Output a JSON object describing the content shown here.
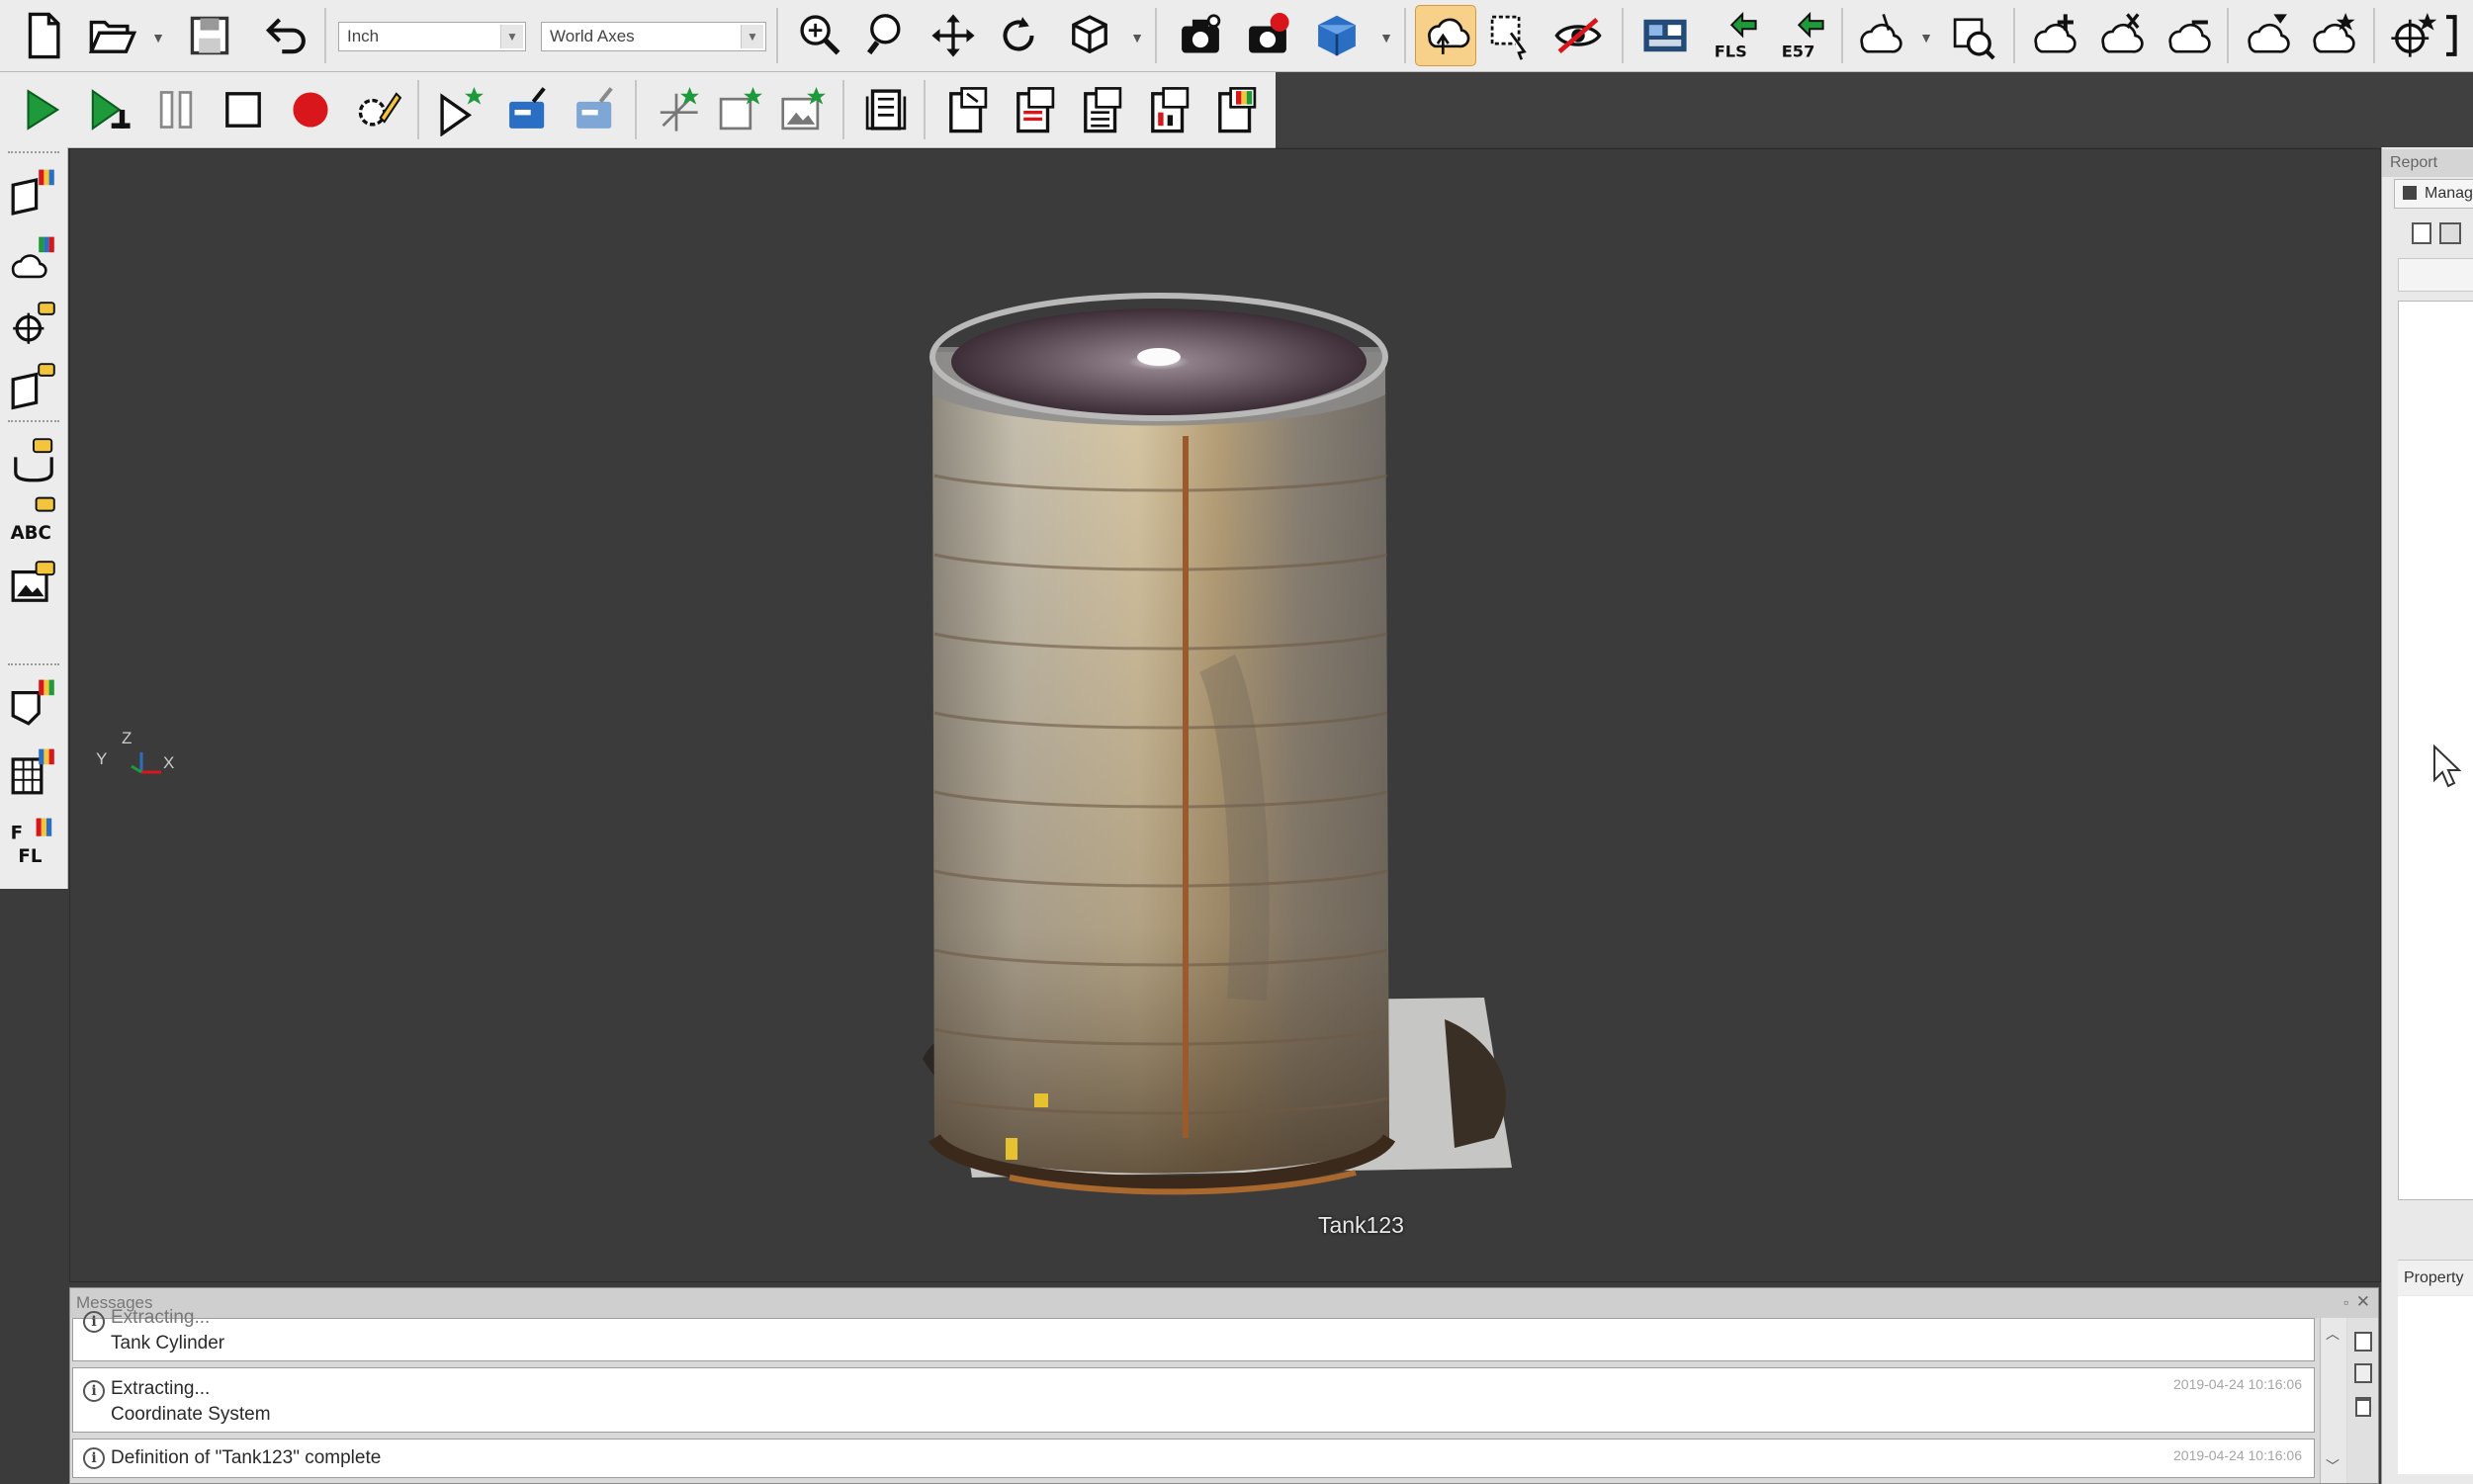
{
  "toolbar": {
    "units_value": "Inch",
    "axes_value": "World Axes"
  },
  "viewport": {
    "object_label": "Tank123",
    "axis_triad": {
      "z": "Z",
      "y": "Y",
      "x": "X"
    }
  },
  "right_panel": {
    "title": "Report",
    "tab_label": "Manag",
    "property_label": "Property"
  },
  "messages": {
    "title": "Messages",
    "rows": [
      {
        "line1": "Extracting...",
        "line2": "Tank Cylinder",
        "timestamp": ""
      },
      {
        "line1": "Extracting...",
        "line2": "Coordinate System",
        "timestamp": "2019-04-24 10:16:06"
      },
      {
        "line1": "Definition of \"Tank123\" complete",
        "line2": "",
        "timestamp": "2019-04-24 10:16:06"
      }
    ]
  },
  "colors": {
    "toolbar_bg": "#ececec",
    "viewport_bg": "#3b3b3b",
    "active_tool": "#f7d08a",
    "run_green": "#1e9a3a",
    "record_red": "#d8161b"
  }
}
